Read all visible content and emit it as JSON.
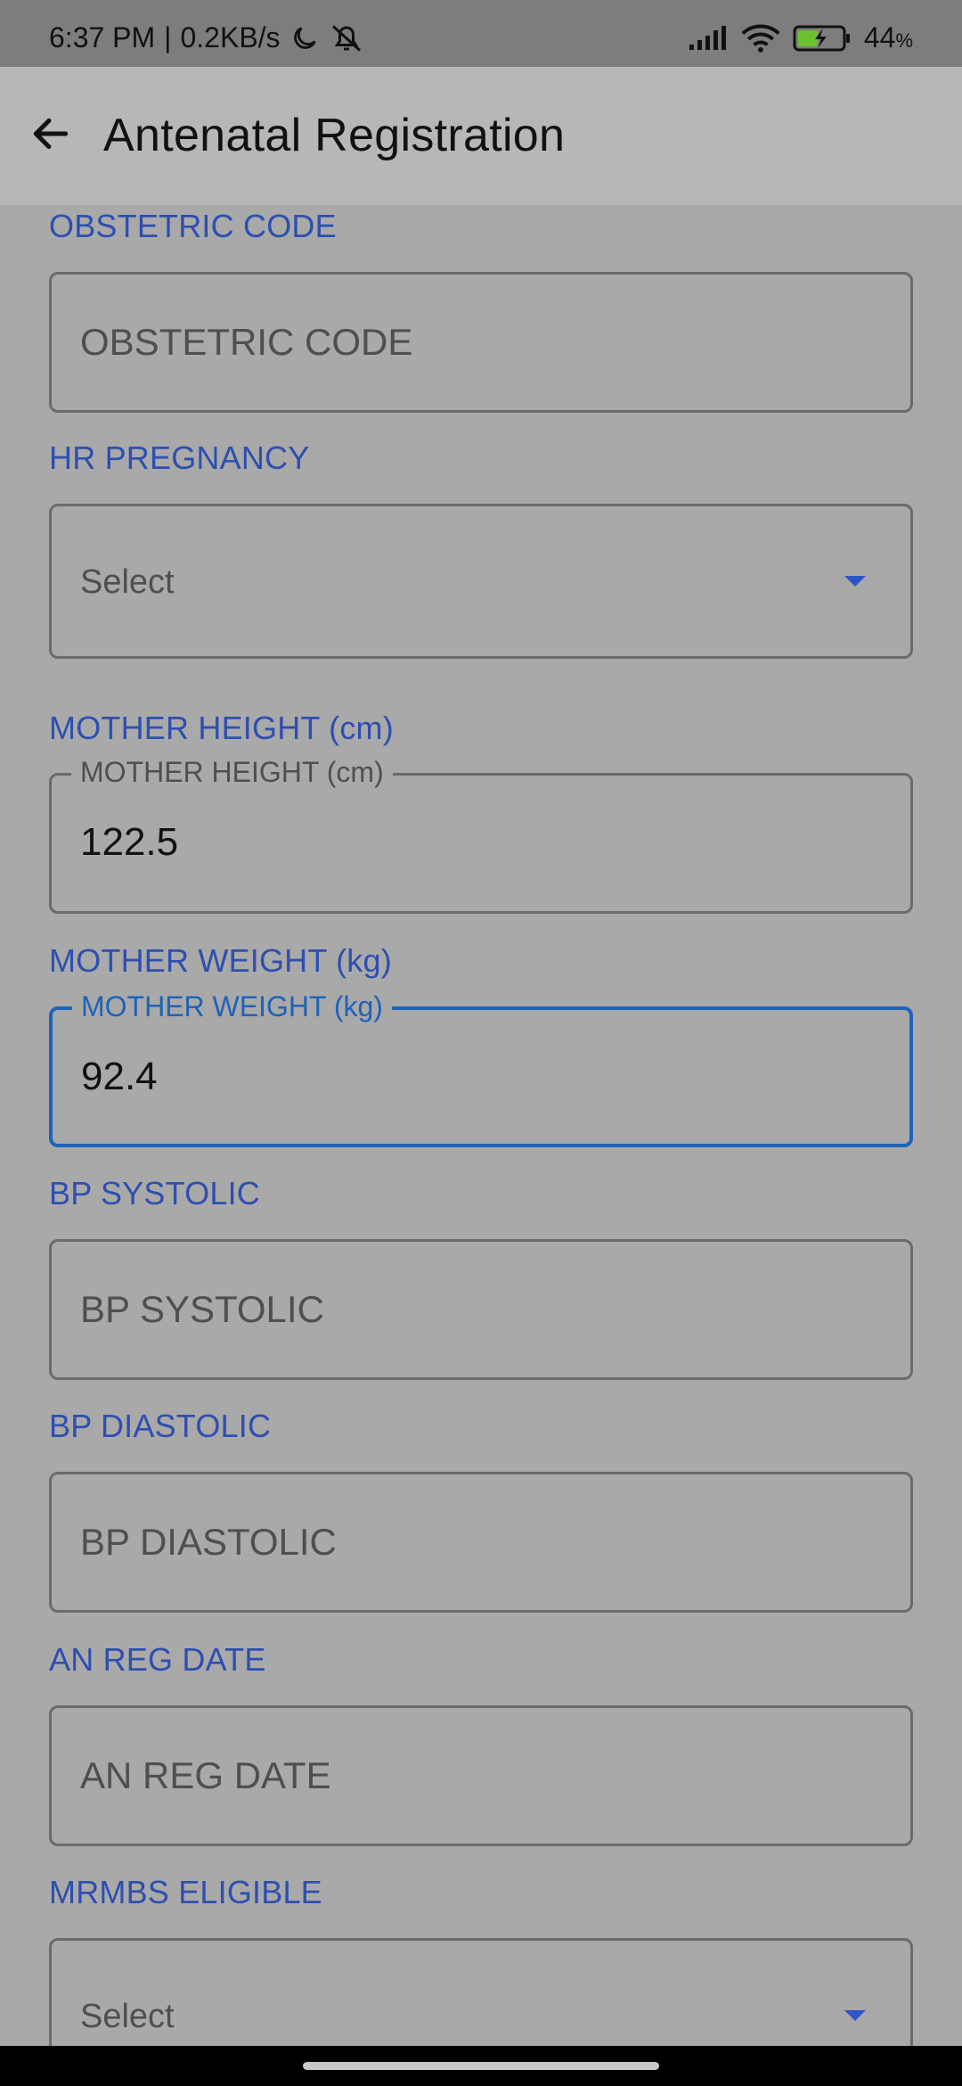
{
  "status_bar": {
    "time": "6:37 PM",
    "speed": "0.2KB/s",
    "separator": "|",
    "battery": "44",
    "battery_unit": "%",
    "icons": [
      "moon-icon",
      "bell-off-icon",
      "signal-icon",
      "wifi-icon",
      "battery-charging-icon"
    ]
  },
  "app_bar": {
    "title": "Antenatal Registration",
    "back_icon": "arrow-left-icon"
  },
  "form": {
    "obstetric_code": {
      "label": "OBSTETRIC CODE",
      "placeholder": "OBSTETRIC CODE"
    },
    "hr_pregnancy": {
      "label": "HR PREGNANCY",
      "selected": "Select"
    },
    "mother_height": {
      "label": "MOTHER HEIGHT (cm)",
      "float_label": "MOTHER HEIGHT (cm)",
      "value": "122.5"
    },
    "mother_weight": {
      "label": "MOTHER WEIGHT (kg)",
      "float_label": "MOTHER WEIGHT (kg)",
      "value": "92.4"
    },
    "bp_systolic": {
      "label": "BP SYSTOLIC",
      "placeholder": "BP SYSTOLIC"
    },
    "bp_diastolic": {
      "label": "BP DIASTOLIC",
      "placeholder": "BP DIASTOLIC"
    },
    "an_reg_date": {
      "label": "AN REG DATE",
      "placeholder": "AN REG DATE"
    },
    "mrmbs_eligible": {
      "label": "MRMBS ELIGIBLE",
      "selected": "Select"
    }
  },
  "colors": {
    "label_blue": "#2e4fb0",
    "focus_blue": "#1e63b8",
    "overlay_gray": "#a9a9a9"
  }
}
